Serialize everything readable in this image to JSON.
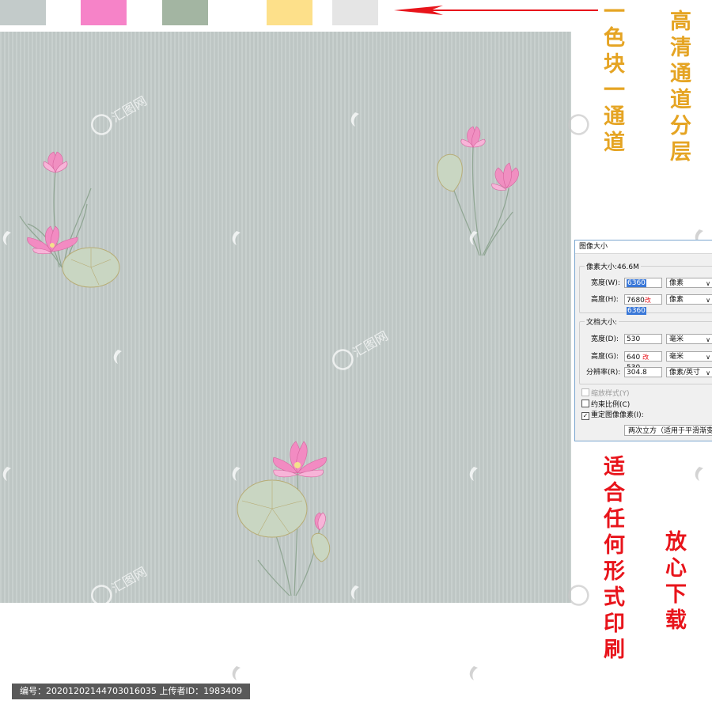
{
  "swatches": {
    "colors": [
      "#c3cbca",
      "#f683c8",
      "#a3b5a2",
      "#fde08a",
      "#e5e5e5"
    ]
  },
  "annotations": {
    "gold_left": "一色块一通道",
    "gold_right": "高清通道分层",
    "red_left": "适合任何形式印刷",
    "red_right": "放心下载",
    "arrow_color": "#e8141b"
  },
  "dialog": {
    "title": "图像大小",
    "pixel_dimensions_label": "像素大小:46.6M",
    "width_label": "宽度(W):",
    "width_value": "6360",
    "width_unit": "像素",
    "height_label": "高度(H):",
    "height_old": "7680",
    "height_mark": "改",
    "height_value": "6360",
    "height_unit": "像素",
    "document_size_label": "文档大小:",
    "doc_width_label": "宽度(D):",
    "doc_width_value": "530",
    "doc_width_unit": "毫米",
    "doc_height_label": "高度(G):",
    "doc_height_old": "640",
    "doc_height_mark": "改",
    "doc_height_value": "530",
    "doc_height_unit": "毫米",
    "resolution_label": "分辨率(R):",
    "resolution_value": "304.8",
    "resolution_unit": "像素/英寸",
    "scale_styles_label": "缩放样式(Y)",
    "constrain_label": "约束比例(C)",
    "resample_label": "重定图像像素(I):",
    "resample_method": "两次立方（适用于平滑渐变）"
  },
  "footer": {
    "text": "编号：20201202144703016035 上传者ID：1983409"
  }
}
